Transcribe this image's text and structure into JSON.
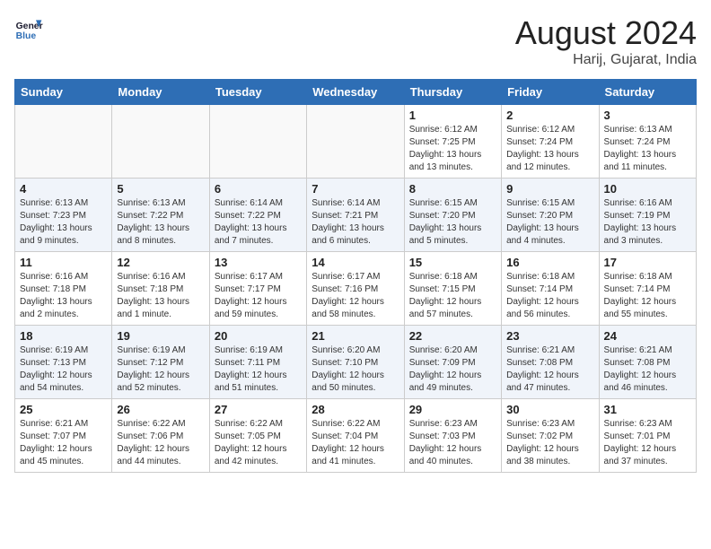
{
  "header": {
    "logo_line1": "General",
    "logo_line2": "Blue",
    "month_year": "August 2024",
    "location": "Harij, Gujarat, India"
  },
  "days_of_week": [
    "Sunday",
    "Monday",
    "Tuesday",
    "Wednesday",
    "Thursday",
    "Friday",
    "Saturday"
  ],
  "weeks": [
    [
      {
        "day": "",
        "info": ""
      },
      {
        "day": "",
        "info": ""
      },
      {
        "day": "",
        "info": ""
      },
      {
        "day": "",
        "info": ""
      },
      {
        "day": "1",
        "info": "Sunrise: 6:12 AM\nSunset: 7:25 PM\nDaylight: 13 hours\nand 13 minutes."
      },
      {
        "day": "2",
        "info": "Sunrise: 6:12 AM\nSunset: 7:24 PM\nDaylight: 13 hours\nand 12 minutes."
      },
      {
        "day": "3",
        "info": "Sunrise: 6:13 AM\nSunset: 7:24 PM\nDaylight: 13 hours\nand 11 minutes."
      }
    ],
    [
      {
        "day": "4",
        "info": "Sunrise: 6:13 AM\nSunset: 7:23 PM\nDaylight: 13 hours\nand 9 minutes."
      },
      {
        "day": "5",
        "info": "Sunrise: 6:13 AM\nSunset: 7:22 PM\nDaylight: 13 hours\nand 8 minutes."
      },
      {
        "day": "6",
        "info": "Sunrise: 6:14 AM\nSunset: 7:22 PM\nDaylight: 13 hours\nand 7 minutes."
      },
      {
        "day": "7",
        "info": "Sunrise: 6:14 AM\nSunset: 7:21 PM\nDaylight: 13 hours\nand 6 minutes."
      },
      {
        "day": "8",
        "info": "Sunrise: 6:15 AM\nSunset: 7:20 PM\nDaylight: 13 hours\nand 5 minutes."
      },
      {
        "day": "9",
        "info": "Sunrise: 6:15 AM\nSunset: 7:20 PM\nDaylight: 13 hours\nand 4 minutes."
      },
      {
        "day": "10",
        "info": "Sunrise: 6:16 AM\nSunset: 7:19 PM\nDaylight: 13 hours\nand 3 minutes."
      }
    ],
    [
      {
        "day": "11",
        "info": "Sunrise: 6:16 AM\nSunset: 7:18 PM\nDaylight: 13 hours\nand 2 minutes."
      },
      {
        "day": "12",
        "info": "Sunrise: 6:16 AM\nSunset: 7:18 PM\nDaylight: 13 hours\nand 1 minute."
      },
      {
        "day": "13",
        "info": "Sunrise: 6:17 AM\nSunset: 7:17 PM\nDaylight: 12 hours\nand 59 minutes."
      },
      {
        "day": "14",
        "info": "Sunrise: 6:17 AM\nSunset: 7:16 PM\nDaylight: 12 hours\nand 58 minutes."
      },
      {
        "day": "15",
        "info": "Sunrise: 6:18 AM\nSunset: 7:15 PM\nDaylight: 12 hours\nand 57 minutes."
      },
      {
        "day": "16",
        "info": "Sunrise: 6:18 AM\nSunset: 7:14 PM\nDaylight: 12 hours\nand 56 minutes."
      },
      {
        "day": "17",
        "info": "Sunrise: 6:18 AM\nSunset: 7:14 PM\nDaylight: 12 hours\nand 55 minutes."
      }
    ],
    [
      {
        "day": "18",
        "info": "Sunrise: 6:19 AM\nSunset: 7:13 PM\nDaylight: 12 hours\nand 54 minutes."
      },
      {
        "day": "19",
        "info": "Sunrise: 6:19 AM\nSunset: 7:12 PM\nDaylight: 12 hours\nand 52 minutes."
      },
      {
        "day": "20",
        "info": "Sunrise: 6:19 AM\nSunset: 7:11 PM\nDaylight: 12 hours\nand 51 minutes."
      },
      {
        "day": "21",
        "info": "Sunrise: 6:20 AM\nSunset: 7:10 PM\nDaylight: 12 hours\nand 50 minutes."
      },
      {
        "day": "22",
        "info": "Sunrise: 6:20 AM\nSunset: 7:09 PM\nDaylight: 12 hours\nand 49 minutes."
      },
      {
        "day": "23",
        "info": "Sunrise: 6:21 AM\nSunset: 7:08 PM\nDaylight: 12 hours\nand 47 minutes."
      },
      {
        "day": "24",
        "info": "Sunrise: 6:21 AM\nSunset: 7:08 PM\nDaylight: 12 hours\nand 46 minutes."
      }
    ],
    [
      {
        "day": "25",
        "info": "Sunrise: 6:21 AM\nSunset: 7:07 PM\nDaylight: 12 hours\nand 45 minutes."
      },
      {
        "day": "26",
        "info": "Sunrise: 6:22 AM\nSunset: 7:06 PM\nDaylight: 12 hours\nand 44 minutes."
      },
      {
        "day": "27",
        "info": "Sunrise: 6:22 AM\nSunset: 7:05 PM\nDaylight: 12 hours\nand 42 minutes."
      },
      {
        "day": "28",
        "info": "Sunrise: 6:22 AM\nSunset: 7:04 PM\nDaylight: 12 hours\nand 41 minutes."
      },
      {
        "day": "29",
        "info": "Sunrise: 6:23 AM\nSunset: 7:03 PM\nDaylight: 12 hours\nand 40 minutes."
      },
      {
        "day": "30",
        "info": "Sunrise: 6:23 AM\nSunset: 7:02 PM\nDaylight: 12 hours\nand 38 minutes."
      },
      {
        "day": "31",
        "info": "Sunrise: 6:23 AM\nSunset: 7:01 PM\nDaylight: 12 hours\nand 37 minutes."
      }
    ]
  ]
}
